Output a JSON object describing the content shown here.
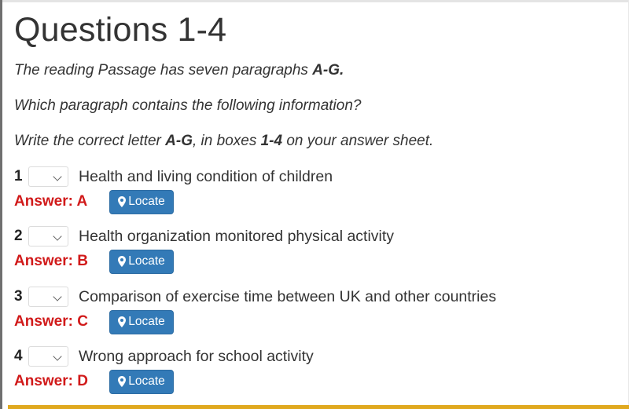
{
  "title": "Questions 1-4",
  "instructions": {
    "line1": {
      "pre": "The reading Passage has seven paragraphs ",
      "bold": "A-G."
    },
    "line2": "Which paragraph contains the following information?",
    "line3": {
      "pre": "Write the correct letter ",
      "bold1": "A-G",
      "mid": ", in boxes ",
      "bold2": "1-4",
      "post": " on your answer sheet."
    }
  },
  "locate_label": "Locate",
  "questions": [
    {
      "number": "1",
      "text": "Health and living condition of children",
      "answer": "Answer: A",
      "selected": ""
    },
    {
      "number": "2",
      "text": "Health organization monitored physical activity",
      "answer": "Answer: B",
      "selected": ""
    },
    {
      "number": "3",
      "text": "Comparison of exercise time between UK and other countries",
      "answer": "Answer: C",
      "selected": ""
    },
    {
      "number": "4",
      "text": "Wrong approach for school activity",
      "answer": "Answer: D",
      "selected": ""
    }
  ],
  "colors": {
    "answer": "#d11a1a",
    "locate_button": "#337ab7",
    "bottom_bar": "#e0a91f"
  }
}
